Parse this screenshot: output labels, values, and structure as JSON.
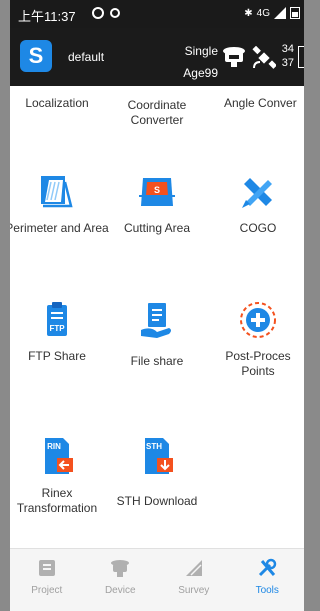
{
  "status_bar": {
    "time": "上午11:37",
    "network": "4G",
    "signal_bars": 4
  },
  "header": {
    "workspace": "default",
    "mode_line1": "Single",
    "mode_line2": "Age99",
    "sat_line1": "34",
    "sat_line2": "37"
  },
  "tools": {
    "localization": "Localization",
    "coordinate_converter_1": "Coordinate",
    "coordinate_converter_2": "Converter",
    "angle_converter": "Angle Conver",
    "perimeter_area": "Perimeter and Area",
    "cutting_area": "Cutting Area",
    "cogo": "COGO",
    "ftp_share": "FTP Share",
    "file_share": "File share",
    "post_process_1": "Post-Proces",
    "post_process_2": "Points",
    "rinex_1": "Rinex",
    "rinex_2": "Transformation",
    "sth_download": "STH Download"
  },
  "icon_text": {
    "ftp": "FTP",
    "rin": "RIN",
    "sth": "STH",
    "s": "S"
  },
  "nav": {
    "project": "Project",
    "device": "Device",
    "survey": "Survey",
    "tools": "Tools",
    "active": "tools"
  },
  "colors": {
    "accent": "#1e88e5",
    "orange": "#f4511e",
    "inactive": "#a0a0a0"
  }
}
